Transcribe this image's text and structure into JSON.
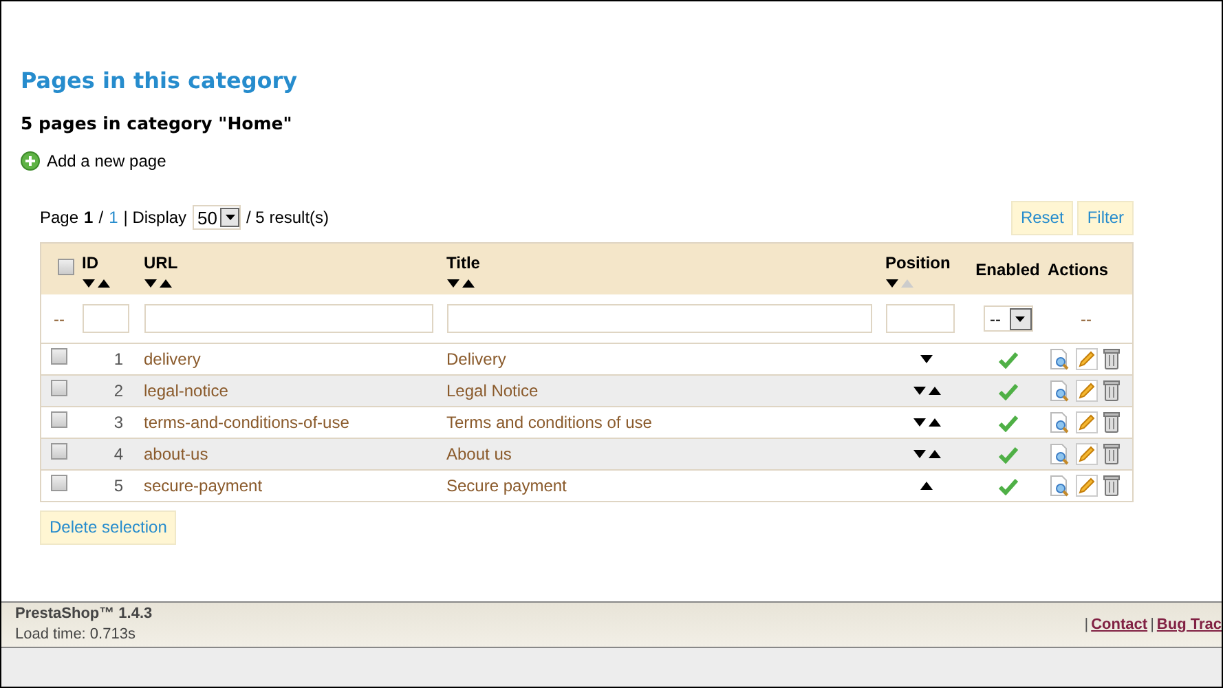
{
  "heading": "Pages in this category",
  "subheading": "5 pages in category \"Home\"",
  "add_link": "Add a new page",
  "pagination": {
    "page_label": "Page",
    "current": "1",
    "sep": "/",
    "total": "1",
    "display_label": "| Display",
    "per_page": "50",
    "results": "/ 5 result(s)"
  },
  "buttons": [
    "Reset",
    "Filter"
  ],
  "table": {
    "select_all": false,
    "columns": [
      {
        "label": "ID",
        "sort_down": true,
        "sort_up": true
      },
      {
        "label": "URL",
        "sort_down": true,
        "sort_up": true
      },
      {
        "label": "Title",
        "sort_down": true,
        "sort_up": true
      },
      {
        "label": "Position",
        "sort_down": true,
        "sort_up": false
      },
      {
        "label": "Enabled"
      },
      {
        "label": "Actions"
      }
    ],
    "filter": {
      "dash": "--",
      "enabled_value": "--",
      "actions_dash": "--"
    },
    "rows": [
      {
        "id": "1",
        "url": "delivery",
        "title": "Delivery",
        "down": true,
        "up": false,
        "enabled": true,
        "checked": false
      },
      {
        "id": "2",
        "url": "legal-notice",
        "title": "Legal Notice",
        "down": true,
        "up": true,
        "enabled": true,
        "checked": false
      },
      {
        "id": "3",
        "url": "terms-and-conditions-of-use",
        "title": "Terms and conditions of use",
        "down": true,
        "up": true,
        "enabled": true,
        "checked": false
      },
      {
        "id": "4",
        "url": "about-us",
        "title": "About us",
        "down": true,
        "up": true,
        "enabled": true,
        "checked": false
      },
      {
        "id": "5",
        "url": "secure-payment",
        "title": "Secure payment",
        "down": false,
        "up": true,
        "enabled": true,
        "checked": false
      }
    ]
  },
  "delete_button": "Delete selection",
  "footer": {
    "brand": "PrestaShop™ 1.4.3",
    "load_time": "Load time: 0.713s",
    "sep1": "|",
    "contact": "Contact",
    "sep2": "|",
    "bug": "Bug Trac"
  }
}
